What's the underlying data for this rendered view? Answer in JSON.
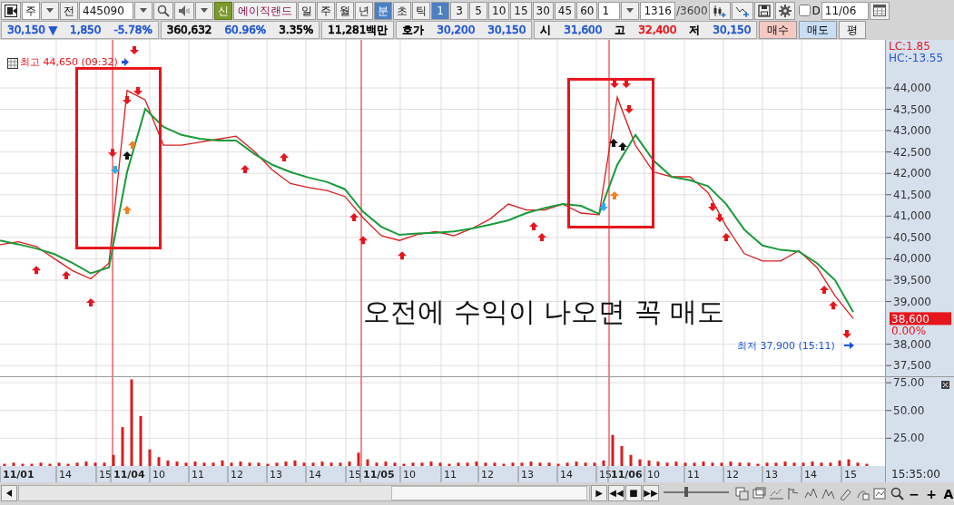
{
  "toolbar": {
    "market": {
      "value": "주"
    },
    "prev_label": "전",
    "code": {
      "value": "445090"
    },
    "credit_badge": "신",
    "stock_name": "에이직랜드",
    "periods": [
      {
        "label": "일",
        "selected": false
      },
      {
        "label": "주",
        "selected": false
      },
      {
        "label": "월",
        "selected": false
      },
      {
        "label": "년",
        "selected": false
      },
      {
        "label": "분",
        "selected": true
      },
      {
        "label": "초",
        "selected": false
      },
      {
        "label": "틱",
        "selected": false
      }
    ],
    "intervals": [
      {
        "label": "1",
        "selected": true
      },
      {
        "label": "3",
        "selected": false
      },
      {
        "label": "5",
        "selected": false
      },
      {
        "label": "10",
        "selected": false
      },
      {
        "label": "15",
        "selected": false
      },
      {
        "label": "30",
        "selected": false
      },
      {
        "label": "45",
        "selected": false
      },
      {
        "label": "60",
        "selected": false
      }
    ],
    "interval_count": {
      "value": "1"
    },
    "bar_count": {
      "value": "1316",
      "total": "/3600"
    },
    "d_option": {
      "label": "D",
      "checked": false
    },
    "date": {
      "value": "11/06"
    }
  },
  "quote_bar": {
    "groups": [
      [
        {
          "text": "30,150 ▼",
          "color": "#1f55d6"
        },
        {
          "text": "1,850",
          "color": "#1f55d6"
        },
        {
          "text": "-5.78%",
          "color": "#1f55d6"
        }
      ],
      [
        {
          "text": "360,632",
          "color": "#000000"
        },
        {
          "text": "60.96%",
          "color": "#1f55d6"
        },
        {
          "text": "3.35%",
          "color": "#000000"
        }
      ],
      [
        {
          "text": "11,281백만",
          "color": "#000000"
        }
      ],
      [
        {
          "text": "호가",
          "color": "#000000"
        },
        {
          "text": "30,200",
          "color": "#1f55d6"
        },
        {
          "text": "30,150",
          "color": "#1f55d6"
        }
      ],
      [
        {
          "text": "시",
          "color": "#000000"
        },
        {
          "text": "31,600",
          "color": "#1f55d6"
        },
        {
          "text": "고",
          "color": "#000000"
        },
        {
          "text": "32,400",
          "color": "#e8141c"
        },
        {
          "text": "저",
          "color": "#000000"
        },
        {
          "text": "30,150",
          "color": "#1f55d6"
        }
      ]
    ],
    "buttons": [
      {
        "label": "매수",
        "kind": "buy"
      },
      {
        "label": "매도",
        "kind": "sell"
      },
      {
        "label": "평",
        "kind": "plain"
      }
    ]
  },
  "price_chart": {
    "high_label": "최고 44,650 (09:32)",
    "low_label": "최저 37,900 (15:11)",
    "lc": "LC:1.85",
    "hc": "HC:-13.55",
    "current_price": "38,600",
    "current_change": "0.00%",
    "note": "오전에 수익이 나오면 꼭 매도",
    "chart_data": {
      "type": "line",
      "grid": true,
      "ylim": [
        37250,
        45125
      ],
      "categories": [
        null,
        null,
        null,
        null,
        null,
        null,
        null,
        null,
        null,
        null,
        null,
        null,
        null,
        null,
        null,
        null,
        null,
        null,
        null,
        null,
        null,
        null,
        null,
        null,
        null,
        null,
        null,
        null,
        null,
        null,
        null,
        null,
        null,
        null,
        null,
        null,
        null,
        null,
        null,
        null,
        null,
        null,
        null,
        null,
        null,
        null,
        null,
        null
      ],
      "series": [
        {
          "color": "#d81e1e",
          "values": [
            40330,
            40400,
            40290,
            40000,
            39720,
            39530,
            39900,
            43940,
            43720,
            42660,
            42660,
            42730,
            42800,
            42870,
            42520,
            42080,
            41760,
            41670,
            41600,
            41460,
            40960,
            40540,
            40430,
            40570,
            40640,
            40540,
            40710,
            40930,
            41280,
            41140,
            41140,
            41280,
            41070,
            41030,
            43780,
            42660,
            42030,
            41920,
            41920,
            41550,
            40760,
            40120,
            39950,
            39950,
            40190,
            39800,
            39130,
            38600
          ]
        },
        {
          "color": "#1a9a3a",
          "values": [
            40430,
            40340,
            40240,
            40110,
            39900,
            39660,
            39800,
            42030,
            43510,
            43090,
            42900,
            42810,
            42770,
            42770,
            42460,
            42200,
            42030,
            41900,
            41800,
            41630,
            41100,
            40750,
            40560,
            40590,
            40610,
            40640,
            40710,
            40800,
            40900,
            41070,
            41190,
            41280,
            41240,
            41050,
            42200,
            42900,
            42300,
            41920,
            41840,
            41700,
            41280,
            40680,
            40310,
            40210,
            40170,
            39900,
            39500,
            38750
          ]
        }
      ],
      "yticks": [
        {
          "value": 37500,
          "label": "37,500"
        },
        {
          "value": 38000,
          "label": "38,000"
        },
        {
          "value": 39000,
          "label": "39,000"
        },
        {
          "value": 39500,
          "label": "39,500"
        },
        {
          "value": 40000,
          "label": "40,000"
        },
        {
          "value": 40500,
          "label": "40,500"
        },
        {
          "value": 41000,
          "label": "41,000"
        },
        {
          "value": 41500,
          "label": "41,500"
        },
        {
          "value": 42000,
          "label": "42,000"
        },
        {
          "value": 42500,
          "label": "42,500"
        },
        {
          "value": 43000,
          "label": "43,000"
        },
        {
          "value": 43500,
          "label": "43,500"
        },
        {
          "value": 44000,
          "label": "44,000"
        }
      ]
    }
  },
  "volume_chart": {
    "chart_data": {
      "type": "bar",
      "grid": true,
      "ylim": [
        0,
        80
      ],
      "categories": [
        null,
        null,
        null,
        null,
        null,
        null,
        null,
        null,
        null,
        null,
        null,
        null,
        null,
        null,
        null,
        null,
        null,
        null,
        null,
        null,
        null,
        null,
        null,
        null,
        null,
        null,
        null,
        null,
        null,
        null,
        null,
        null,
        null,
        null,
        null,
        null,
        null,
        null,
        null,
        null,
        null,
        null,
        null,
        null,
        null,
        null,
        null,
        null,
        null,
        null,
        null,
        null,
        null,
        null,
        null,
        null,
        null,
        null,
        null,
        null,
        null,
        null,
        null,
        null,
        null,
        null,
        null,
        null,
        null,
        null,
        null,
        null,
        null,
        null,
        null,
        null,
        null,
        null,
        null,
        null,
        null,
        null,
        null,
        null,
        null,
        null,
        null,
        null,
        null,
        null,
        null,
        null,
        null,
        null,
        null,
        null,
        null,
        null
      ],
      "series": [
        {
          "color": "#d81e1e",
          "values": [
            2,
            3,
            2,
            2,
            3,
            2,
            3,
            2,
            3,
            4,
            3,
            3,
            10,
            35,
            78,
            45,
            15,
            8,
            5,
            4,
            3,
            4,
            3,
            3,
            5,
            3,
            4,
            3,
            3,
            2,
            3,
            4,
            5,
            3,
            3,
            4,
            3,
            3,
            4,
            12,
            6,
            3,
            4,
            3,
            2,
            3,
            3,
            4,
            3,
            2,
            3,
            3,
            4,
            3,
            3,
            2,
            3,
            3,
            4,
            3,
            3,
            2,
            3,
            4,
            3,
            3,
            5,
            28,
            18,
            10,
            6,
            5,
            4,
            3,
            4,
            3,
            3,
            4,
            3,
            3,
            4,
            3,
            3,
            2,
            3,
            3,
            4,
            3,
            3,
            4,
            3,
            3,
            5,
            6,
            3,
            2,
            null,
            null
          ]
        }
      ],
      "yticks": [
        {
          "value": 25,
          "label": "25.00"
        },
        {
          "value": 50,
          "label": "50.00"
        },
        {
          "value": 75,
          "label": "75.00"
        }
      ]
    }
  },
  "x_axis": {
    "labels": [
      {
        "text": "11/01",
        "bold": true
      },
      {
        "text": "14",
        "bold": false
      },
      {
        "text": "15",
        "bold": false
      },
      {
        "text": "11/04",
        "bold": true
      },
      {
        "text": "10",
        "bold": false
      },
      {
        "text": "11",
        "bold": false
      },
      {
        "text": "12",
        "bold": false
      },
      {
        "text": "13",
        "bold": false
      },
      {
        "text": "14",
        "bold": false
      },
      {
        "text": "15",
        "bold": false
      },
      {
        "text": "11/05",
        "bold": true
      },
      {
        "text": "10",
        "bold": false
      },
      {
        "text": "11",
        "bold": false
      },
      {
        "text": "12",
        "bold": false
      },
      {
        "text": "13",
        "bold": false
      },
      {
        "text": "14",
        "bold": false
      },
      {
        "text": "15",
        "bold": false
      },
      {
        "text": "11/06",
        "bold": true
      },
      {
        "text": "10",
        "bold": false
      },
      {
        "text": "11",
        "bold": false
      },
      {
        "text": "12",
        "bold": false
      },
      {
        "text": "13",
        "bold": false
      },
      {
        "text": "14",
        "bold": false
      },
      {
        "text": "15",
        "bold": false
      }
    ],
    "time": "15:35:00"
  },
  "bottom_bar": {
    "player_controls": [
      "▶",
      "◀◀",
      "■",
      "▶▶"
    ],
    "zoom_slider": {
      "level": 0.35
    },
    "zoom_controls": [
      "−",
      "+",
      "A"
    ]
  }
}
